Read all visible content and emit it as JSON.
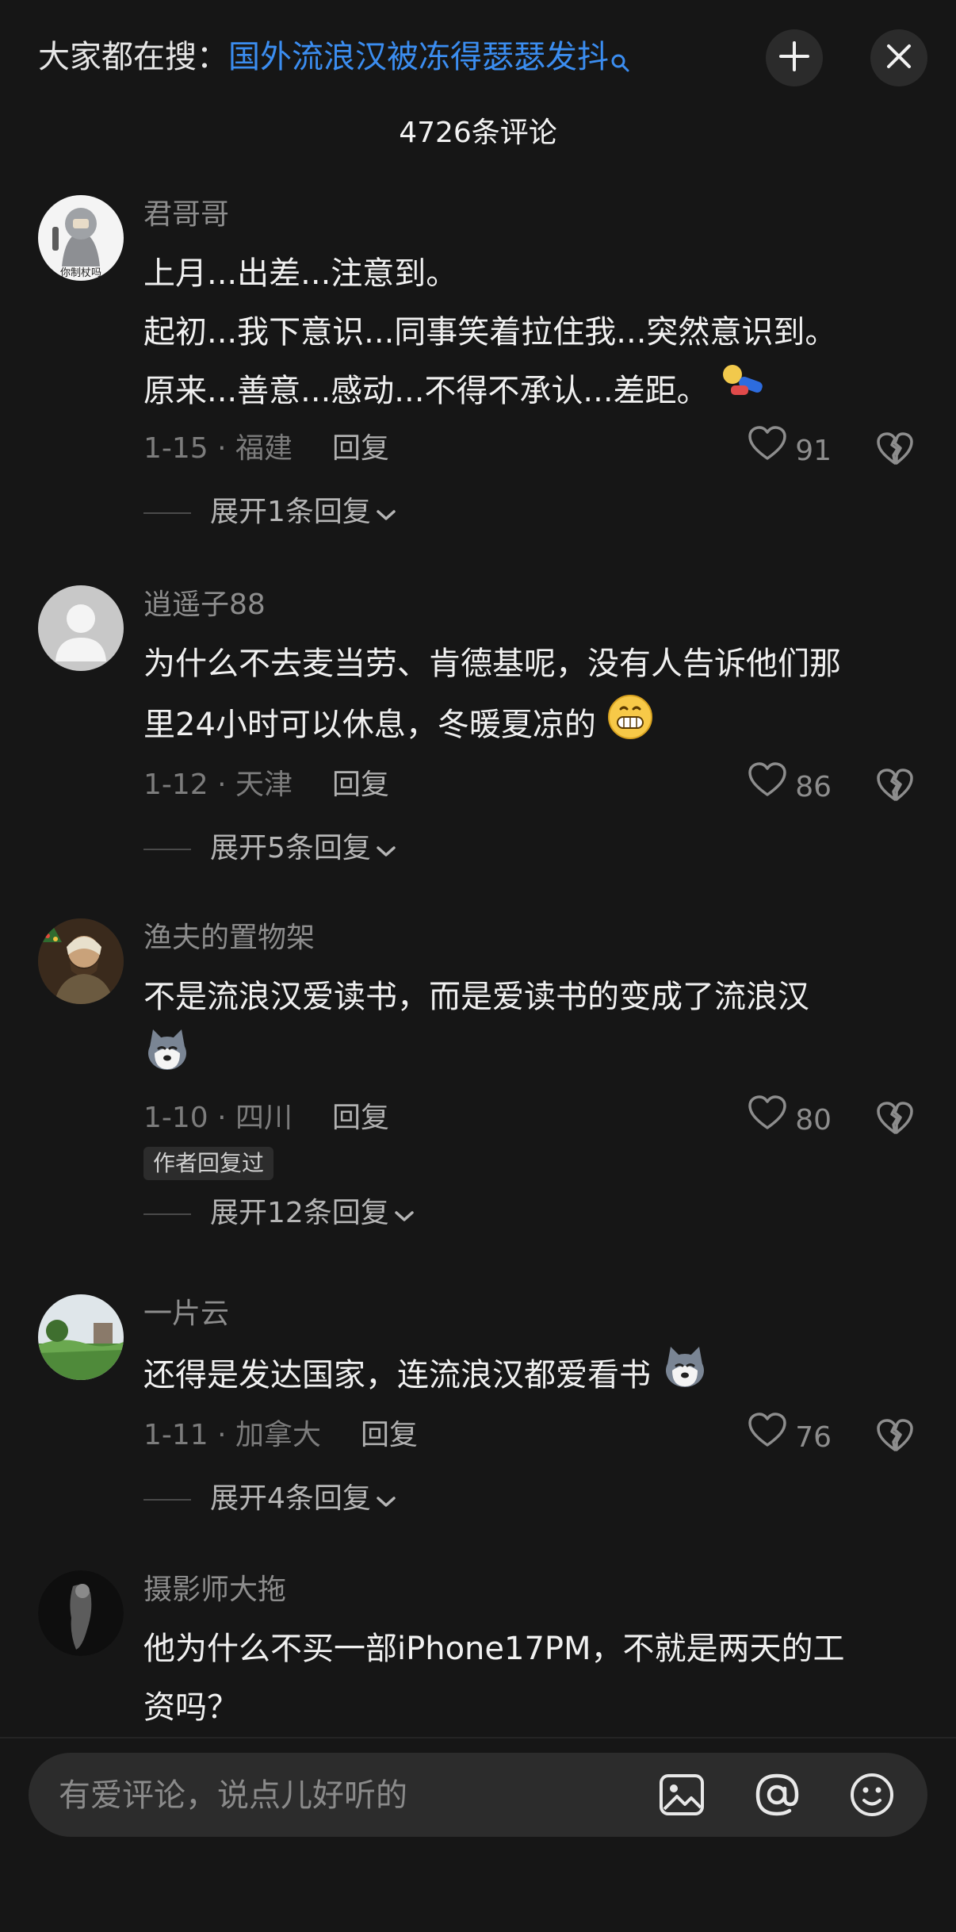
{
  "header": {
    "search_prefix": "大家都在搜：",
    "search_term": "国外流浪汉被冻得瑟瑟发抖",
    "comment_count": "4726条评论"
  },
  "comments": [
    {
      "author": "君哥哥",
      "avatar_text": "你制杖吗",
      "lines": [
        "上月...出差...注意到。",
        "起初...我下意识...同事笑着拉住我...突然意识到。",
        "原来...善意...感动...不得不承认...差距。"
      ],
      "date_loc": "1-15 · 福建",
      "reply": "回复",
      "likes": "91",
      "expand": "展开1条回复"
    },
    {
      "author": "逍遥子88",
      "lines": [
        "为什么不去麦当劳、肯德基呢，没有人告诉他们那",
        "里24小时可以休息，冬暖夏凉的"
      ],
      "date_loc": "1-12 · 天津",
      "reply": "回复",
      "likes": "86",
      "expand": "展开5条回复"
    },
    {
      "author": "渔夫的置物架",
      "lines": [
        "不是流浪汉爱读书，而是爱读书的变成了流浪汉"
      ],
      "date_loc": "1-10 · 四川",
      "reply": "回复",
      "likes": "80",
      "badge": "作者回复过",
      "expand": "展开12条回复"
    },
    {
      "author": "一片云",
      "lines": [
        "还得是发达国家，连流浪汉都爱看书"
      ],
      "date_loc": "1-11 · 加拿大",
      "reply": "回复",
      "likes": "76",
      "expand": "展开4条回复"
    },
    {
      "author": "摄影师大拖",
      "lines": [
        "他为什么不买一部iPhone17PM，不就是两天的工",
        "资吗？"
      ]
    }
  ],
  "input": {
    "placeholder": "有爱评论，说点儿好听的"
  },
  "icons": [
    "search-icon",
    "collapse-icon",
    "close-icon",
    "heart-icon",
    "broken-heart-icon",
    "chevron-down-icon",
    "image-icon",
    "at-icon",
    "emoji-icon"
  ],
  "colors": {
    "background": "#161616",
    "accent": "#3b8df0"
  }
}
